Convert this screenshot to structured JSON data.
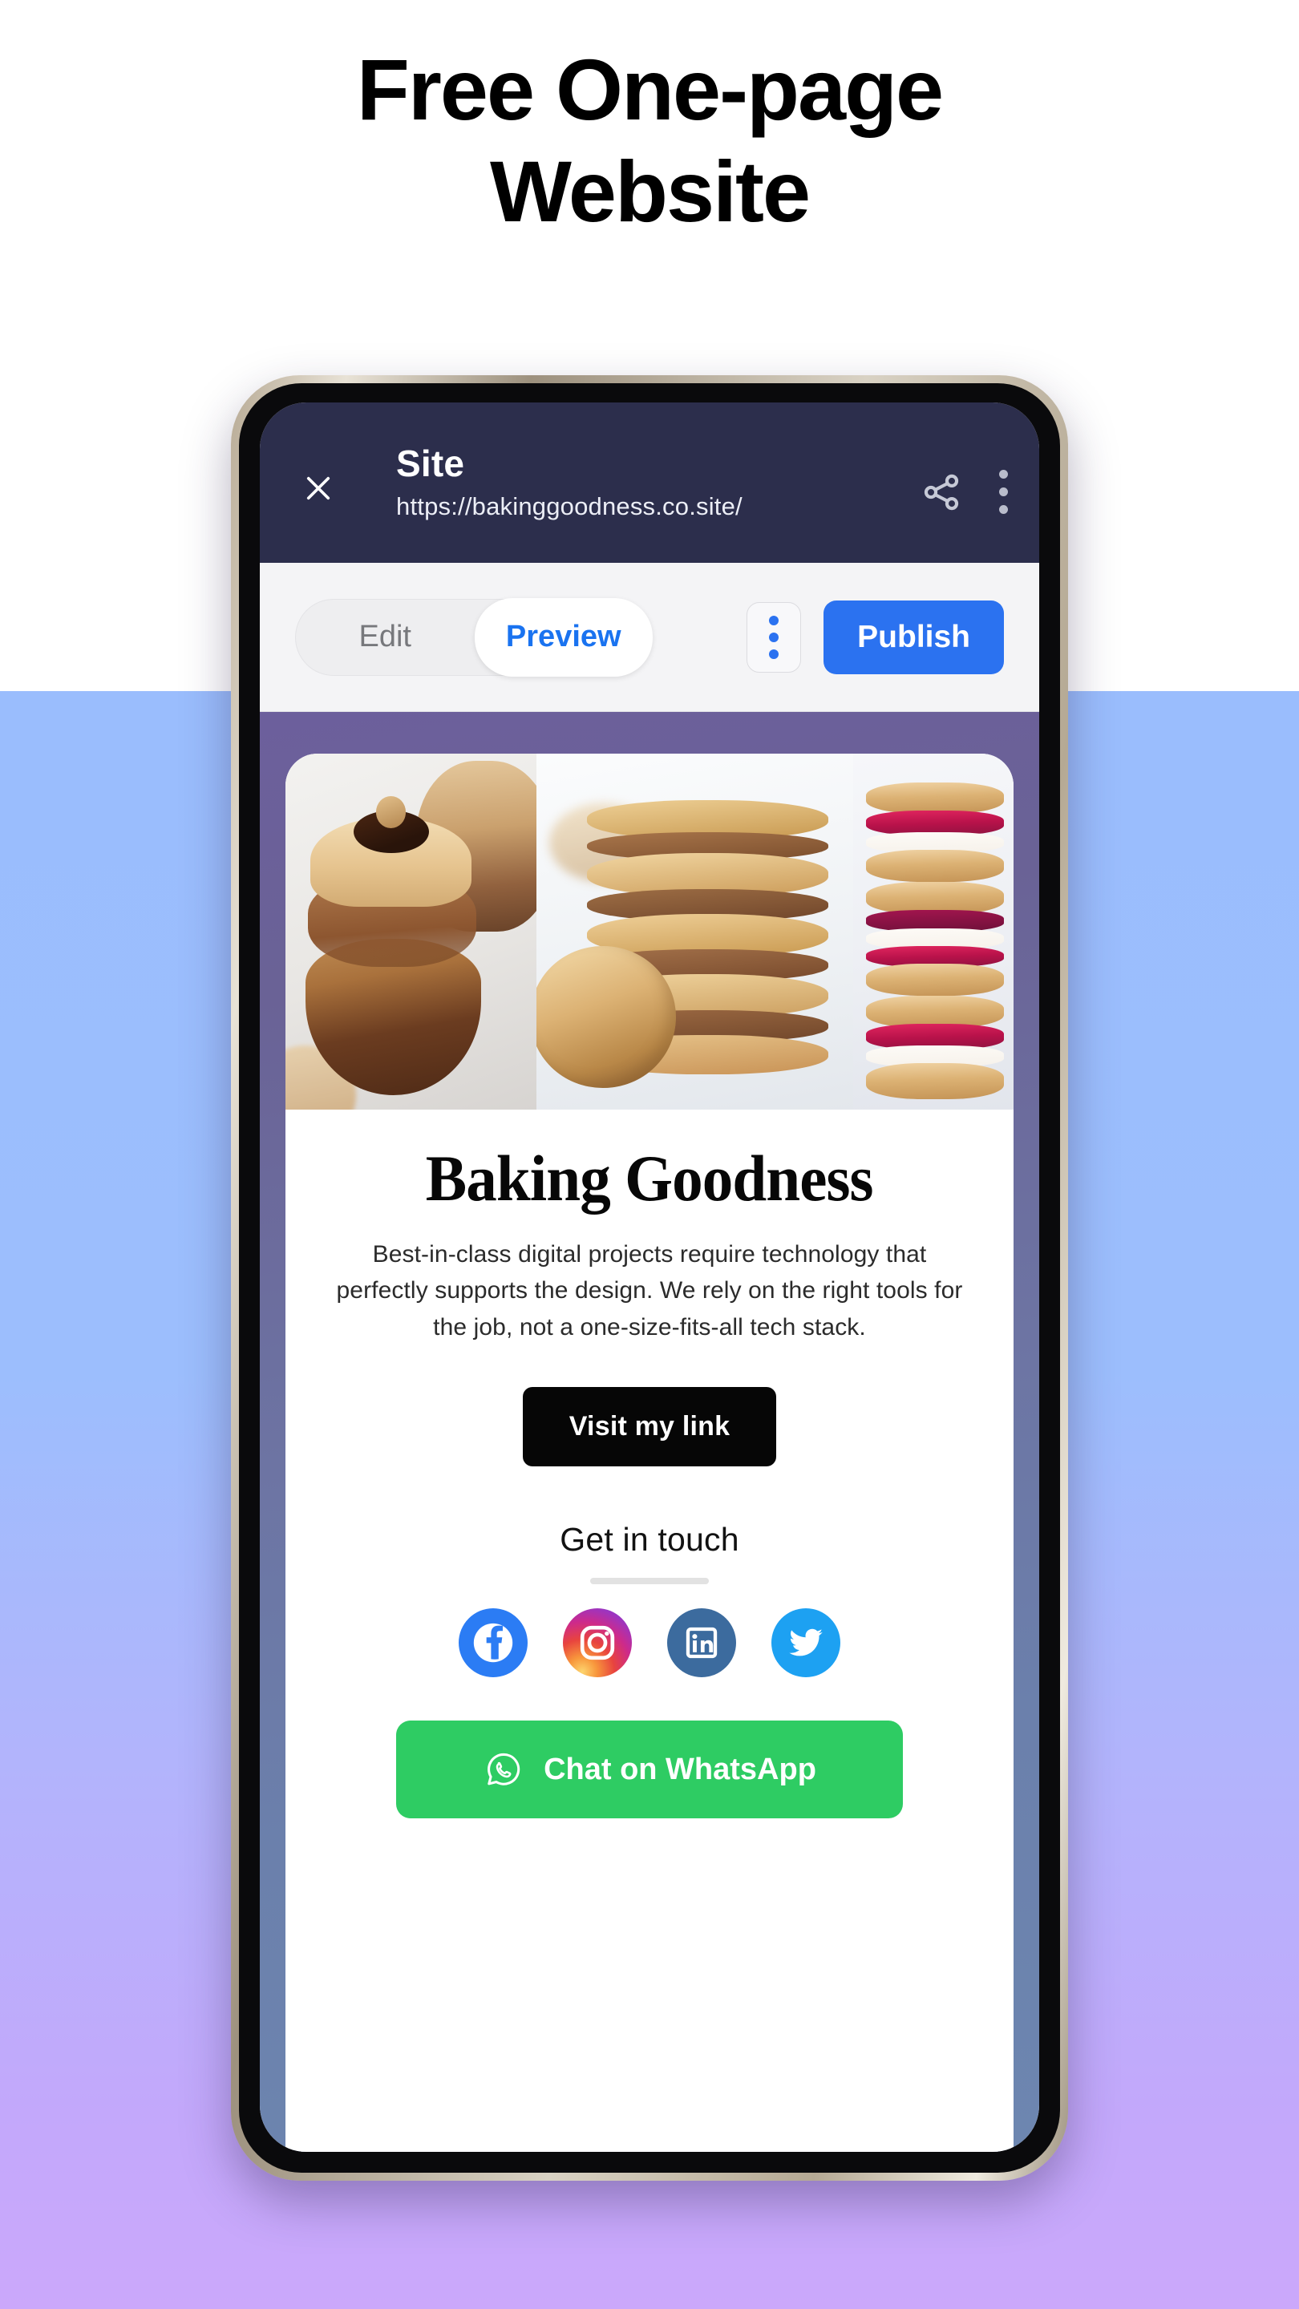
{
  "promo": {
    "line1": "Free One-page",
    "line2": "Website"
  },
  "app_header": {
    "close_icon": "close-icon",
    "title": "Site",
    "url": "https://bakinggoodness.co.site/",
    "share_icon": "share-icon",
    "overflow_icon": "more-vertical-icon",
    "background_color": "#2c2e4c"
  },
  "toolbar": {
    "segmented": {
      "edit_label": "Edit",
      "preview_label": "Preview",
      "active": "Preview"
    },
    "overflow_icon": "more-vertical-icon",
    "publish_label": "Publish",
    "publish_color": "#2b72f0",
    "background_color": "#f4f4f6"
  },
  "site": {
    "background_gradient_from": "#6c5f9c",
    "background_gradient_to": "#6d86b0",
    "collage": [
      {
        "name": "chocolate-hazelnut-dessert-photo"
      },
      {
        "name": "almond-cookie-stack-photo"
      },
      {
        "name": "raspberry-cream-sandwich-cookies-photo"
      }
    ],
    "title": "Baking Goodness",
    "description": "Best-in-class digital projects require technology that perfectly supports the design. We rely on the right tools for the job, not a one-size-fits-all tech stack.",
    "visit_label": "Visit my link",
    "visit_color": "#060606",
    "contact_title": "Get in touch",
    "social": [
      {
        "name": "facebook",
        "color": "#2b7cf4"
      },
      {
        "name": "instagram",
        "color": "#cd2a8b"
      },
      {
        "name": "linkedin",
        "color": "#3c6b9e"
      },
      {
        "name": "twitter",
        "color": "#1da1f2"
      }
    ],
    "whatsapp_label": "Chat on WhatsApp",
    "whatsapp_color": "#2ecc63"
  },
  "page_background": {
    "top_color": "#ffffff",
    "gradient_from": "#9ABDFD",
    "gradient_to": "#CBA8FB"
  }
}
